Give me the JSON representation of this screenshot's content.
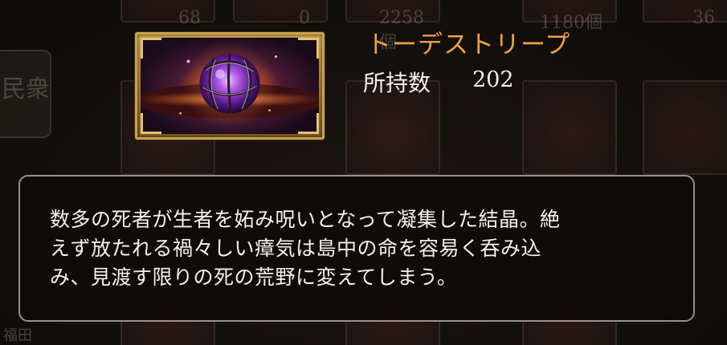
{
  "item": {
    "name": "トーデストリープ",
    "count_label": "所持数",
    "count_value": "202",
    "icon": "purple-orb-crystal-icon",
    "name_color": "#f0a23a",
    "frame_color": "#c9a24f"
  },
  "description": {
    "lines": [
      "数多の死者が生者を妬み呪いとなって凝集した結晶。絶",
      "えず放たれる禍々しい瘴気は島中の命を容易く呑み込",
      "み、見渡す限りの死の荒野に変えてしまう。"
    ]
  },
  "background": {
    "counts": [
      "68個",
      "0個",
      "2258個",
      "1180個",
      "36"
    ],
    "side_label": "民衆",
    "footer_label": "福田"
  }
}
